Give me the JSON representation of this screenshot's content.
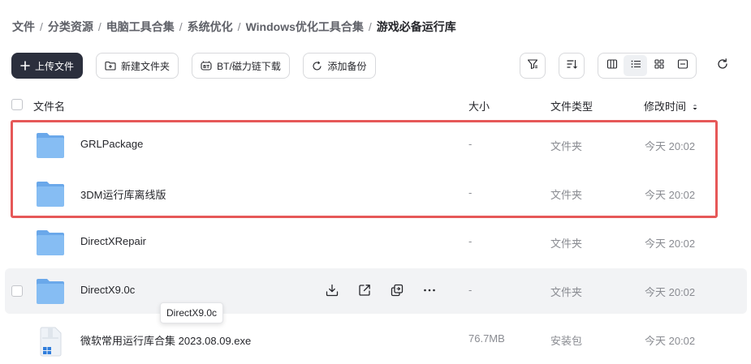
{
  "breadcrumb": [
    {
      "label": "文件"
    },
    {
      "label": "分类资源"
    },
    {
      "label": "电脑工具合集"
    },
    {
      "label": "系统优化"
    },
    {
      "label": "Windows优化工具合集"
    },
    {
      "label": "游戏必备运行库"
    }
  ],
  "breadcrumb_separator": "/",
  "toolbar": {
    "upload_label": "上传文件",
    "new_folder_label": "新建文件夹",
    "bt_label": "BT/磁力链下载",
    "backup_label": "添加备份"
  },
  "header": {
    "name": "文件名",
    "size": "大小",
    "type": "文件类型",
    "time": "修改时间"
  },
  "files": [
    {
      "name": "GRLPackage",
      "size": "-",
      "type": "文件夹",
      "time": "今天 20:02",
      "kind": "folder"
    },
    {
      "name": "3DM运行库离线版",
      "size": "-",
      "type": "文件夹",
      "time": "今天 20:02",
      "kind": "folder"
    },
    {
      "name": "DirectXRepair",
      "size": "-",
      "type": "文件夹",
      "time": "今天 20:02",
      "kind": "folder"
    },
    {
      "name": "DirectX9.0c",
      "size": "-",
      "type": "文件夹",
      "time": "今天 20:02",
      "kind": "folder"
    },
    {
      "name": "微软常用运行库合集 2023.08.09.exe",
      "size": "76.7MB",
      "type": "安装包",
      "time": "今天 20:02",
      "kind": "installer"
    }
  ],
  "tooltip": "DirectX9.0c",
  "colors": {
    "primary_button": "#2b2f3d",
    "highlight_border": "#e65858",
    "folder_blue": "#7cb5f0",
    "hover_row": "#f2f3f5"
  },
  "icons": [
    "plus-icon",
    "new-folder-icon",
    "bt-icon",
    "backup-icon",
    "filter-icon",
    "sort-icon",
    "columns-view-icon",
    "list-view-icon",
    "grid-view-icon",
    "preview-view-icon",
    "refresh-icon",
    "sort-arrows-icon",
    "download-icon",
    "share-icon",
    "copy-icon",
    "more-icon",
    "folder-icon",
    "installer-icon"
  ]
}
